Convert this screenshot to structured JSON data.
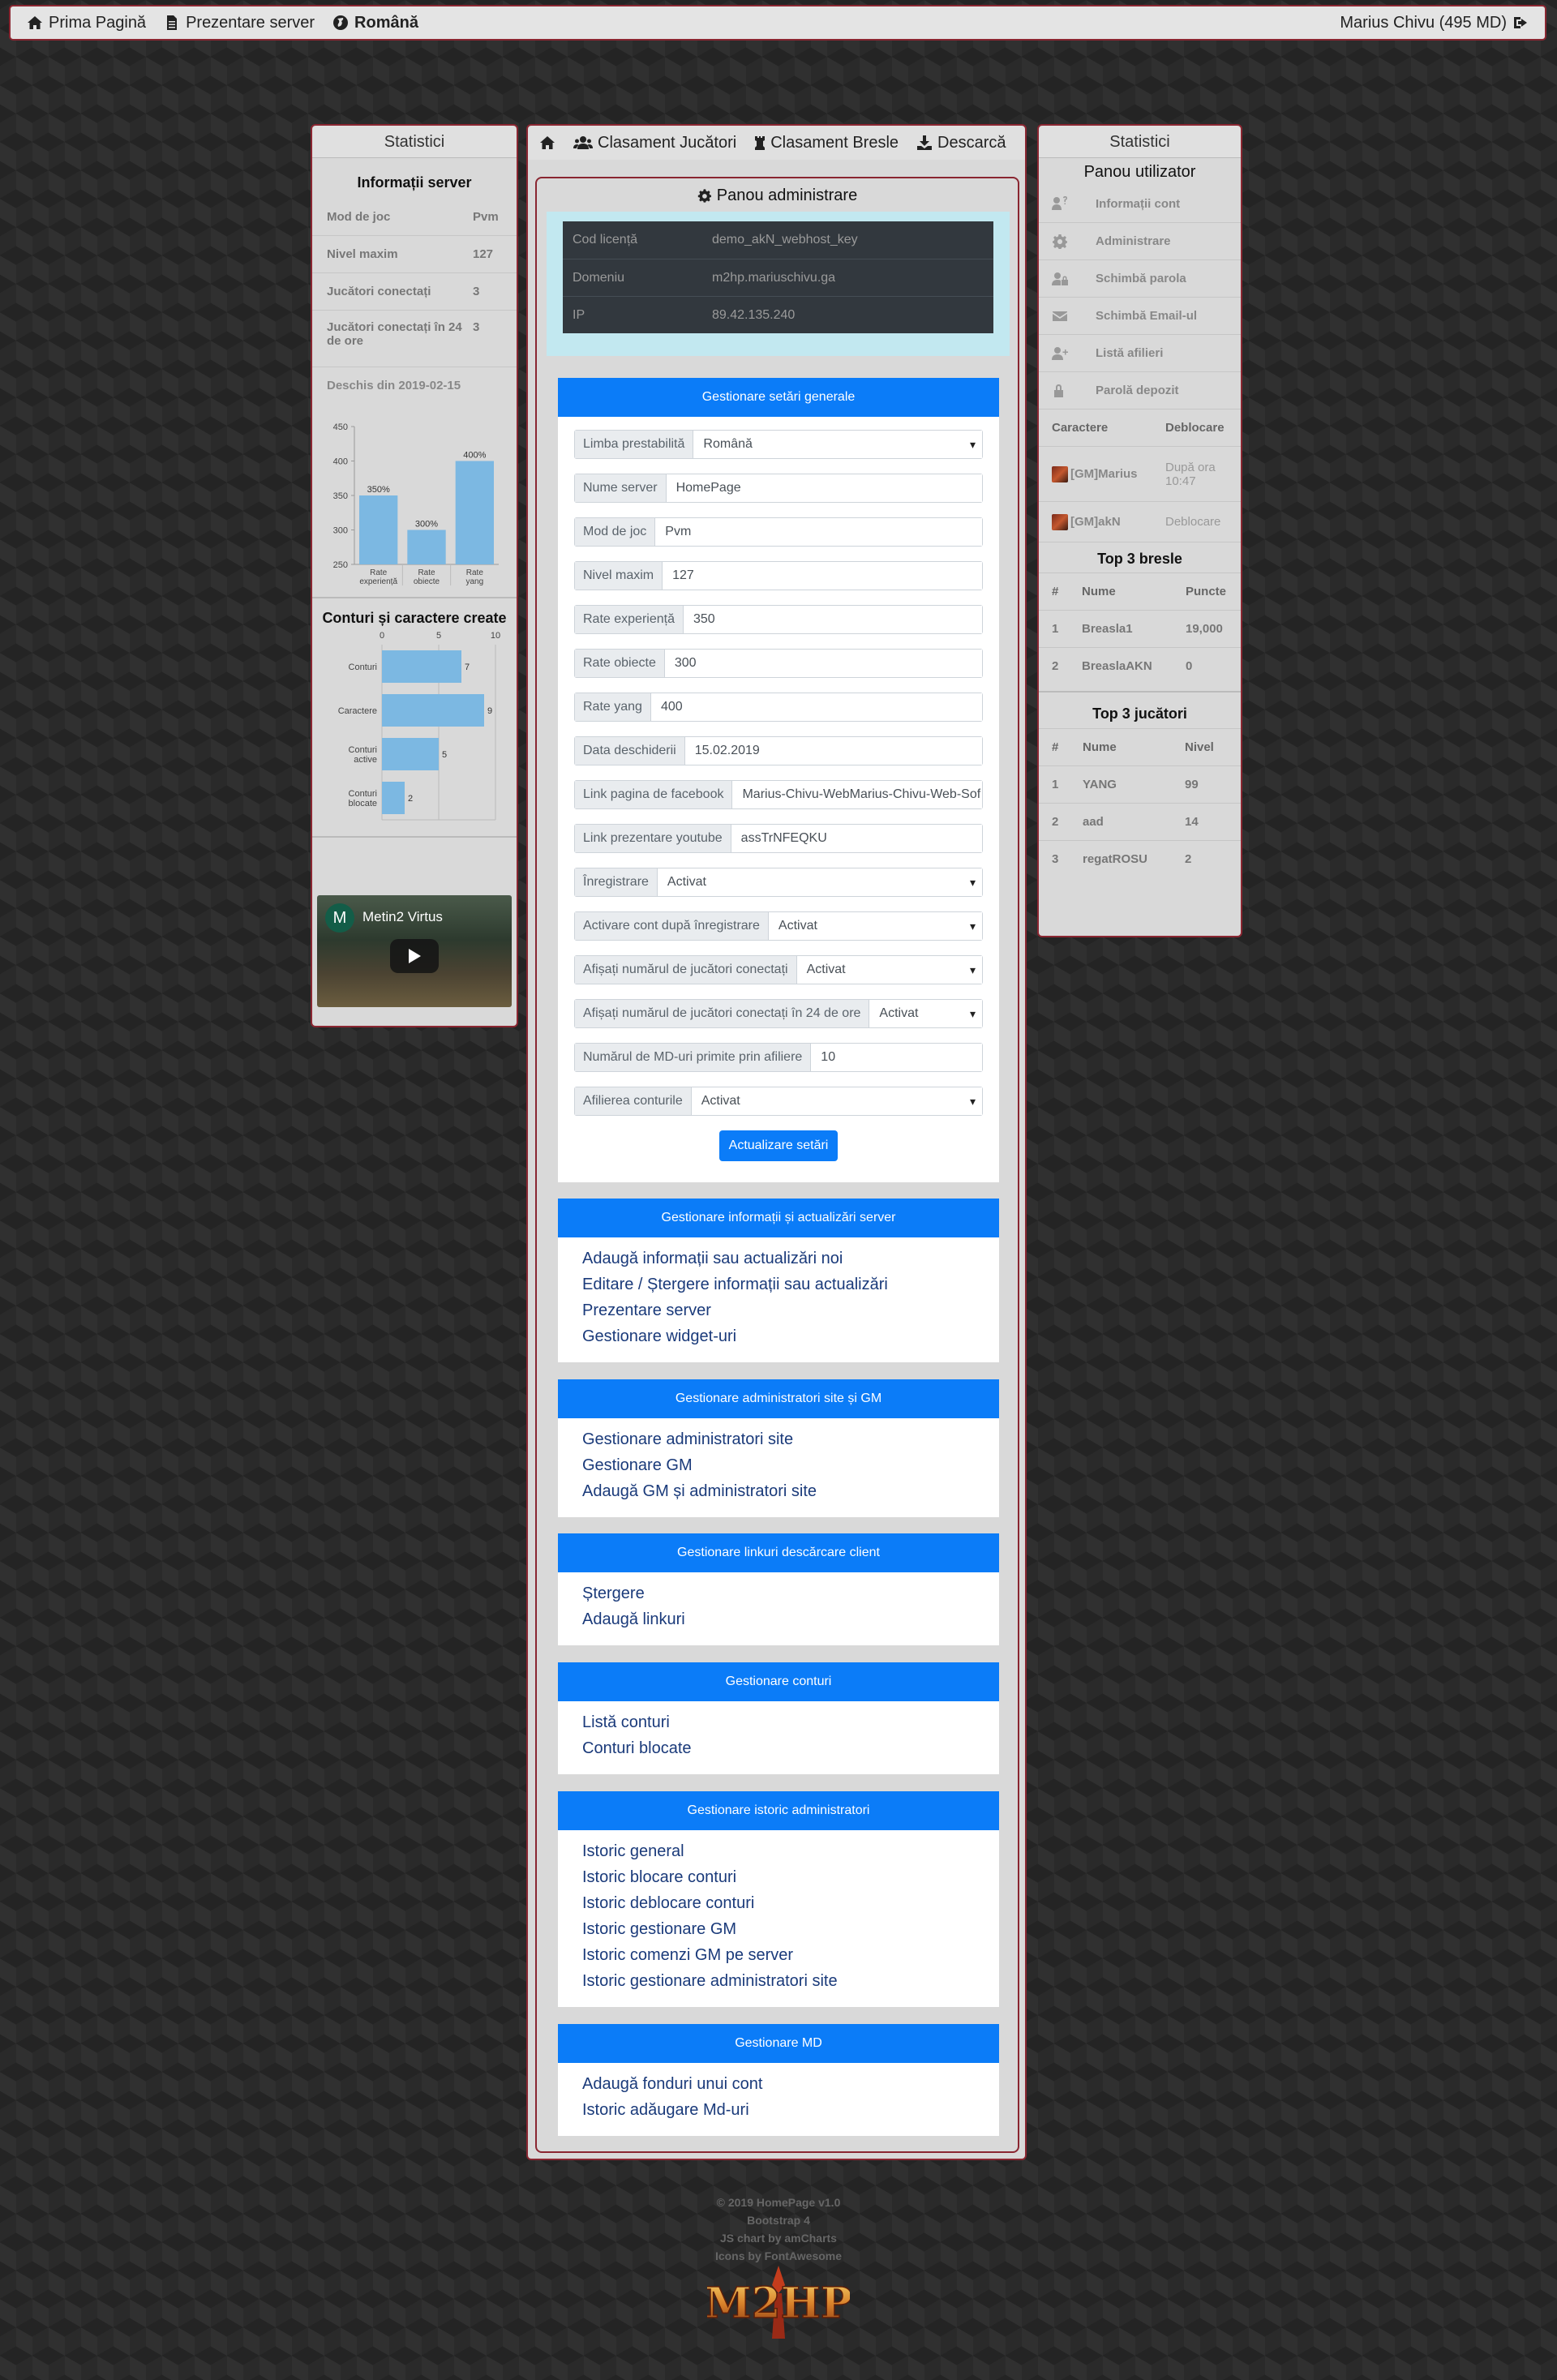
{
  "topnav": {
    "home": "Prima Pagină",
    "presentation": "Prezentare server",
    "language": "Română",
    "user": "Marius Chivu (495 MD)"
  },
  "left": {
    "header": "Statistici",
    "info_title": "Informații server",
    "rows": [
      {
        "key": "Mod de joc",
        "value": "Pvm"
      },
      {
        "key": "Nivel maxim",
        "value": "127"
      },
      {
        "key": "Jucători conectați",
        "value": "3"
      },
      {
        "key": "Jucători conectați în 24 de ore",
        "value": "3"
      }
    ],
    "opened": "Deschis din 2019-02-15",
    "accounts_title": "Conturi și caractere create",
    "video_title": "Metin2 Virtus",
    "video_avatar": "M"
  },
  "chart_data": [
    {
      "type": "bar",
      "categories": [
        "Rate experiență",
        "Rate obiecte",
        "Rate yang"
      ],
      "values": [
        350,
        300,
        400
      ],
      "data_labels": [
        "350%",
        "300%",
        "400%"
      ],
      "ylim": [
        250,
        450
      ],
      "yticks": [
        250,
        300,
        350,
        400,
        450
      ],
      "color": "#7cb8e2"
    },
    {
      "type": "bar",
      "orientation": "horizontal",
      "categories": [
        "Conturi",
        "Caractere",
        "Conturi active",
        "Conturi blocate"
      ],
      "values": [
        7,
        9,
        5,
        2
      ],
      "xlim": [
        0,
        10
      ],
      "xticks": [
        0,
        5,
        10
      ],
      "color": "#7cb8e2"
    }
  ],
  "center": {
    "tabs": [
      "Clasament Jucători",
      "Clasament Bresle",
      "Descarcă"
    ],
    "admin_title": "Panou administrare",
    "license": [
      {
        "key": "Cod licență",
        "value": "demo_akN_webhost_key"
      },
      {
        "key": "Domeniu",
        "value": "m2hp.mariuschivu.ga"
      },
      {
        "key": "IP",
        "value": "89.42.135.240"
      }
    ],
    "settings": {
      "header": "Gestionare setări generale",
      "fields": [
        {
          "label": "Limba prestabilită",
          "value": "Română"
        },
        {
          "label": "Nume server",
          "value": "HomePage"
        },
        {
          "label": "Mod de joc",
          "value": "Pvm"
        },
        {
          "label": "Nivel maxim",
          "value": "127"
        },
        {
          "label": "Rate experiență",
          "value": "350"
        },
        {
          "label": "Rate obiecte",
          "value": "300"
        },
        {
          "label": "Rate yang",
          "value": "400"
        },
        {
          "label": "Data deschiderii",
          "value": "15.02.2019"
        },
        {
          "label": "Link pagina de facebook",
          "value": "Marius-Chivu-WebMarius-Chivu-Web-Sof"
        },
        {
          "label": "Link prezentare youtube",
          "value": "assTrNFEQKU"
        },
        {
          "label": "Înregistrare",
          "value": "Activat"
        },
        {
          "label": "Activare cont după înregistrare",
          "value": "Activat"
        },
        {
          "label": "Afișați numărul de jucători conectați",
          "value": "Activat"
        },
        {
          "label": "Afișați numărul de jucători conectați în 24 de ore",
          "value": "Activat"
        },
        {
          "label": "Numărul de MD-uri primite prin afiliere",
          "value": "10"
        },
        {
          "label": "Afilierea conturile",
          "value": "Activat"
        }
      ],
      "button": "Actualizare setări"
    },
    "sections": [
      {
        "header": "Gestionare informații și actualizări server",
        "links": [
          "Adaugă informații sau actualizări noi",
          "Editare / Ștergere informații sau actualizări",
          "Prezentare server",
          "Gestionare widget-uri"
        ]
      },
      {
        "header": "Gestionare administratori site și GM",
        "links": [
          "Gestionare administratori site",
          "Gestionare GM",
          "Adaugă GM și administratori site"
        ]
      },
      {
        "header": "Gestionare linkuri descărcare client",
        "links": [
          "Ștergere",
          "Adaugă linkuri"
        ]
      },
      {
        "header": "Gestionare conturi",
        "links": [
          "Listă conturi",
          "Conturi blocate"
        ]
      },
      {
        "header": "Gestionare istoric administratori",
        "links": [
          "Istoric general",
          "Istoric blocare conturi",
          "Istoric deblocare conturi",
          "Istoric gestionare GM",
          "Istoric comenzi GM pe server",
          "Istoric gestionare administratori site"
        ]
      },
      {
        "header": "Gestionare MD",
        "links": [
          "Adaugă fonduri unui cont",
          "Istoric adăugare Md-uri"
        ]
      }
    ]
  },
  "right": {
    "header": "Statistici",
    "user_panel": "Panou utilizator",
    "menu": [
      {
        "icon": "user-question-icon",
        "label": "Informații cont"
      },
      {
        "icon": "gear-icon",
        "label": "Administrare"
      },
      {
        "icon": "user-lock-icon",
        "label": "Schimbă parola"
      },
      {
        "icon": "envelope-icon",
        "label": "Schimbă Email-ul"
      },
      {
        "icon": "user-plus-icon",
        "label": "Listă afilieri"
      },
      {
        "icon": "lock-icon",
        "label": "Parolă depozit"
      }
    ],
    "characters": {
      "headers": [
        "Caractere",
        "Deblocare"
      ],
      "rows": [
        {
          "name": "[GM]Marius",
          "status": "După ora 10:47"
        },
        {
          "name": "[GM]akN",
          "status": "Deblocare"
        }
      ]
    },
    "top_guilds": {
      "title": "Top 3 bresle",
      "headers": [
        "#",
        "Nume",
        "Puncte"
      ],
      "rows": [
        {
          "rank": "1",
          "name": "Breasla1",
          "value": "19,000"
        },
        {
          "rank": "2",
          "name": "BreaslaAKN",
          "value": "0"
        }
      ]
    },
    "top_players": {
      "title": "Top 3 jucători",
      "headers": [
        "#",
        "Nume",
        "Nivel"
      ],
      "rows": [
        {
          "rank": "1",
          "name": "YANG",
          "value": "99"
        },
        {
          "rank": "2",
          "name": "aad",
          "value": "14"
        },
        {
          "rank": "3",
          "name": "regatROSU",
          "value": "2"
        }
      ]
    }
  },
  "footer": {
    "lines": [
      "© 2019 HomePage v1.0",
      "Bootstrap 4",
      "JS chart by amCharts",
      "Icons by FontAwesome"
    ],
    "logo_text": "M2HP"
  }
}
